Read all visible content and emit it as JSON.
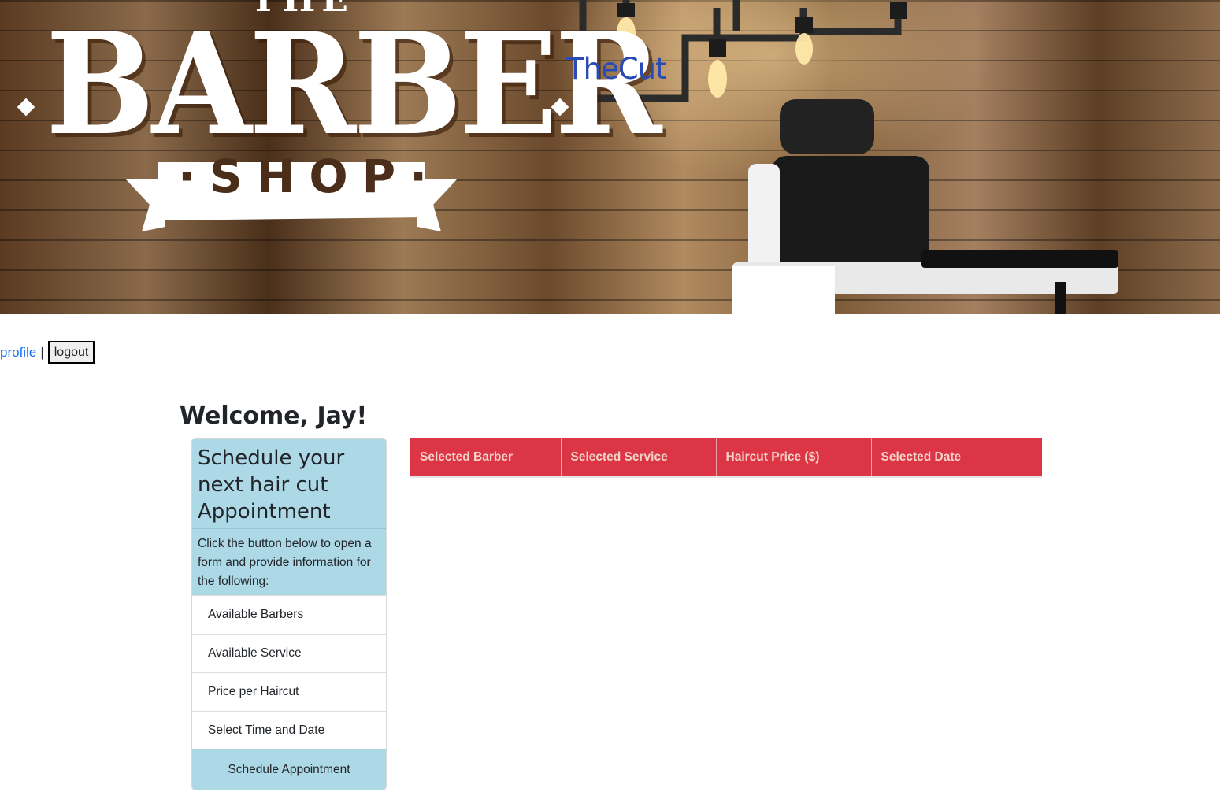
{
  "hero": {
    "logo": {
      "the": "THE",
      "barber": "BARBER",
      "shop": "·SHOP·"
    },
    "brand_name": "TheCut"
  },
  "nav": {
    "profile_link": "profile",
    "separator": "|",
    "logout_button": "logout"
  },
  "welcome": "Welcome, Jay!",
  "card": {
    "title": "Schedule your next hair cut Appointment",
    "text": "Click the button below to open a form and provide information for the following:",
    "items": [
      "Available Barbers",
      "Available Service",
      "Price per Haircut",
      "Select Time and Date"
    ],
    "action": "Schedule Appointment",
    "accent_color": "#add8e6"
  },
  "table": {
    "header_color": "#dc3545",
    "columns": [
      "Selected Barber",
      "Selected Service",
      "Haircut Price ($)",
      "Selected Date",
      ""
    ],
    "rows": []
  },
  "colors": {
    "link": "#0d6efd",
    "brand": "#2a4bb5"
  }
}
